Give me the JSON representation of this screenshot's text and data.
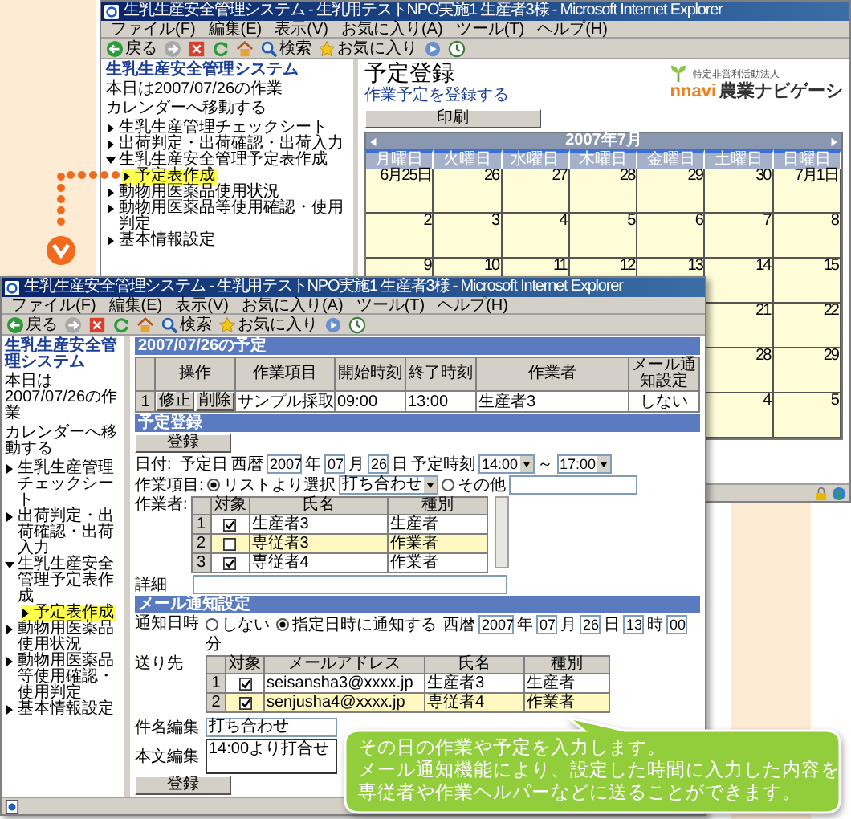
{
  "top_window": {
    "title": "生乳生産安全管理システム - 生乳用テストNPO実施1 生産者3様 - Microsoft Internet Explorer",
    "menu": [
      "ファイル(F)",
      "編集(E)",
      "表示(V)",
      "お気に入り(A)",
      "ツール(T)",
      "ヘルプ(H)"
    ],
    "toolbar": [
      {
        "kind": "back",
        "label": "戻る"
      },
      {
        "kind": "forward"
      },
      {
        "kind": "stop"
      },
      {
        "kind": "refresh"
      },
      {
        "kind": "home"
      },
      {
        "kind": "search",
        "label": "検索"
      },
      {
        "kind": "favorites",
        "label": "お気に入り"
      },
      {
        "kind": "media"
      },
      {
        "kind": "history"
      }
    ],
    "sidebar": {
      "title": "生乳生産安全管理システム",
      "date_note": "本日は2007/07/26の作業",
      "calendar_link": "カレンダーへ移動する",
      "tree": [
        {
          "label": "生乳生産管理チェックシート",
          "expanded": false
        },
        {
          "label": "出荷判定・出荷確認・出荷入力",
          "expanded": false
        },
        {
          "label": "生乳生産安全管理予定表作成",
          "expanded": true,
          "children": [
            {
              "label": "予定表作成",
              "selected": true
            }
          ]
        },
        {
          "label": "動物用医薬品使用状況",
          "expanded": false
        },
        {
          "label": "動物用医薬品等使用確認・使用判定",
          "expanded": false
        },
        {
          "label": "基本情報設定",
          "expanded": false
        }
      ]
    },
    "page": {
      "heading": "予定登録",
      "link": "作業予定を登録する",
      "logo": {
        "org": "特定非営利活動法人",
        "brand": "nnavi",
        "name": "農業ナビゲーシ"
      },
      "print_button": "印刷",
      "calendar": {
        "month": "2007年7月",
        "weekdays": [
          "月曜日",
          "火曜日",
          "水曜日",
          "木曜日",
          "金曜日",
          "土曜日",
          "日曜日"
        ],
        "weeks": [
          [
            "6月25日",
            "26",
            "27",
            "28",
            "29",
            "30",
            "7月1日"
          ],
          [
            "2",
            "3",
            "4",
            "5",
            "6",
            "7",
            "8"
          ],
          [
            "9",
            "10",
            "11",
            "12",
            "13",
            "14",
            "15"
          ],
          [
            "21",
            "22"
          ],
          [
            "28",
            "29"
          ],
          [
            "4",
            "5"
          ]
        ]
      }
    }
  },
  "bottom_window": {
    "title": "生乳生産安全管理システム - 生乳用テストNPO実施1 生産者3様 - Microsoft Internet Explorer",
    "menu": [
      "ファイル(F)",
      "編集(E)",
      "表示(V)",
      "お気に入り(A)",
      "ツール(T)",
      "ヘルプ(H)"
    ],
    "toolbar": [
      {
        "kind": "back",
        "label": "戻る"
      },
      {
        "kind": "forward"
      },
      {
        "kind": "stop"
      },
      {
        "kind": "refresh"
      },
      {
        "kind": "home"
      },
      {
        "kind": "search",
        "label": "検索"
      },
      {
        "kind": "favorites",
        "label": "お気に入り"
      },
      {
        "kind": "media"
      },
      {
        "kind": "history"
      }
    ],
    "sidebar": {
      "title": "生乳生産安全管理システム",
      "date_note": "本日は2007/07/26の作業",
      "calendar_link": "カレンダーへ移動する",
      "tree": [
        {
          "label": "生乳生産管理チェックシート",
          "expanded": false
        },
        {
          "label": "出荷判定・出荷確認・出荷入力",
          "expanded": false
        },
        {
          "label": "生乳生産安全管理予定表作成",
          "expanded": true,
          "children": [
            {
              "label": "予定表作成",
              "selected": true
            }
          ]
        },
        {
          "label": "動物用医薬品使用状況",
          "expanded": false
        },
        {
          "label": "動物用医薬品等使用確認・使用判定",
          "expanded": false
        },
        {
          "label": "基本情報設定",
          "expanded": false
        }
      ]
    },
    "page": {
      "schedule": {
        "heading": "2007/07/26の予定",
        "columns": [
          "",
          "操作",
          "作業項目",
          "開始時刻",
          "終了時刻",
          "作業者",
          "メール通知設定"
        ],
        "rows": [
          {
            "no": "1",
            "actions": [
              "修正",
              "削除"
            ],
            "item": "サンプル採取",
            "start": "09:00",
            "end": "13:00",
            "worker": "生産者3",
            "mail": "しない"
          }
        ]
      },
      "register": {
        "heading": "予定登録",
        "submit": "登録",
        "date": {
          "label": "日付:",
          "parts": [
            {
              "kind": "text",
              "text": "予定日"
            },
            {
              "kind": "text",
              "text": "西暦"
            },
            {
              "kind": "field",
              "value": "2007"
            },
            {
              "kind": "text",
              "text": "年"
            },
            {
              "kind": "field",
              "value": "07"
            },
            {
              "kind": "text",
              "text": "月"
            },
            {
              "kind": "field",
              "value": "26"
            },
            {
              "kind": "text",
              "text": "日"
            },
            {
              "kind": "text",
              "text": "予定時刻"
            },
            {
              "kind": "select",
              "value": "14:00"
            },
            {
              "kind": "text",
              "text": "～"
            },
            {
              "kind": "select",
              "value": "17:00"
            }
          ]
        },
        "work_item": {
          "label": "作業項目:",
          "options": [
            {
              "kind": "select",
              "label": "リストより選択",
              "selected": true,
              "value": "打ち合わせ"
            },
            {
              "kind": "text",
              "label": "その他",
              "selected": false
            }
          ]
        },
        "workers": {
          "label": "作業者:",
          "columns": [
            "対象",
            "氏名",
            "種別"
          ],
          "rows": [
            {
              "no": "1",
              "checked": true,
              "name": "生産者3",
              "type": "生産者",
              "selected": false
            },
            {
              "no": "2",
              "checked": false,
              "name": "専従者3",
              "type": "作業者",
              "selected": true
            },
            {
              "no": "3",
              "checked": true,
              "name": "専従者4",
              "type": "作業者",
              "selected": false
            }
          ]
        },
        "detail": {
          "label": "詳細"
        }
      },
      "mail": {
        "heading": "メール通知設定",
        "notify": {
          "label": "通知日時",
          "options": [
            {
              "label": "しない",
              "selected": false
            },
            {
              "label": "指定日時に通知する",
              "selected": true
            }
          ],
          "parts": [
            {
              "kind": "text",
              "text": "西暦"
            },
            {
              "kind": "field",
              "value": "2007"
            },
            {
              "kind": "text",
              "text": "年"
            },
            {
              "kind": "field",
              "value": "07"
            },
            {
              "kind": "text",
              "text": "月"
            },
            {
              "kind": "field",
              "value": "26"
            },
            {
              "kind": "text",
              "text": "日"
            },
            {
              "kind": "field",
              "value": "13"
            },
            {
              "kind": "text",
              "text": "時"
            },
            {
              "kind": "field",
              "value": "00"
            },
            {
              "kind": "text",
              "text": "分"
            }
          ]
        },
        "recipients": {
          "label": "送り先",
          "columns": [
            "対象",
            "メールアドレス",
            "氏名",
            "種別"
          ],
          "rows": [
            {
              "no": "1",
              "checked": true,
              "email": "seisansha3@xxxx.jp",
              "name": "生産者3",
              "type": "生産者",
              "selected": false
            },
            {
              "no": "2",
              "checked": true,
              "email": "senjusha4@xxxx.jp",
              "name": "専従者4",
              "type": "作業者",
              "selected": true
            }
          ]
        },
        "subject": {
          "label": "件名編集",
          "value": "打ち合わせ"
        },
        "body": {
          "label": "本文編集",
          "value": "14:00より打合せ"
        },
        "submit": "登録"
      }
    }
  },
  "callout": {
    "lines": [
      "その日の作業や予定を入力します。",
      "メール通知機能により、設定した時間に入力した内容を",
      "専従者や作業ヘルパーなどに送ることができます。"
    ]
  }
}
